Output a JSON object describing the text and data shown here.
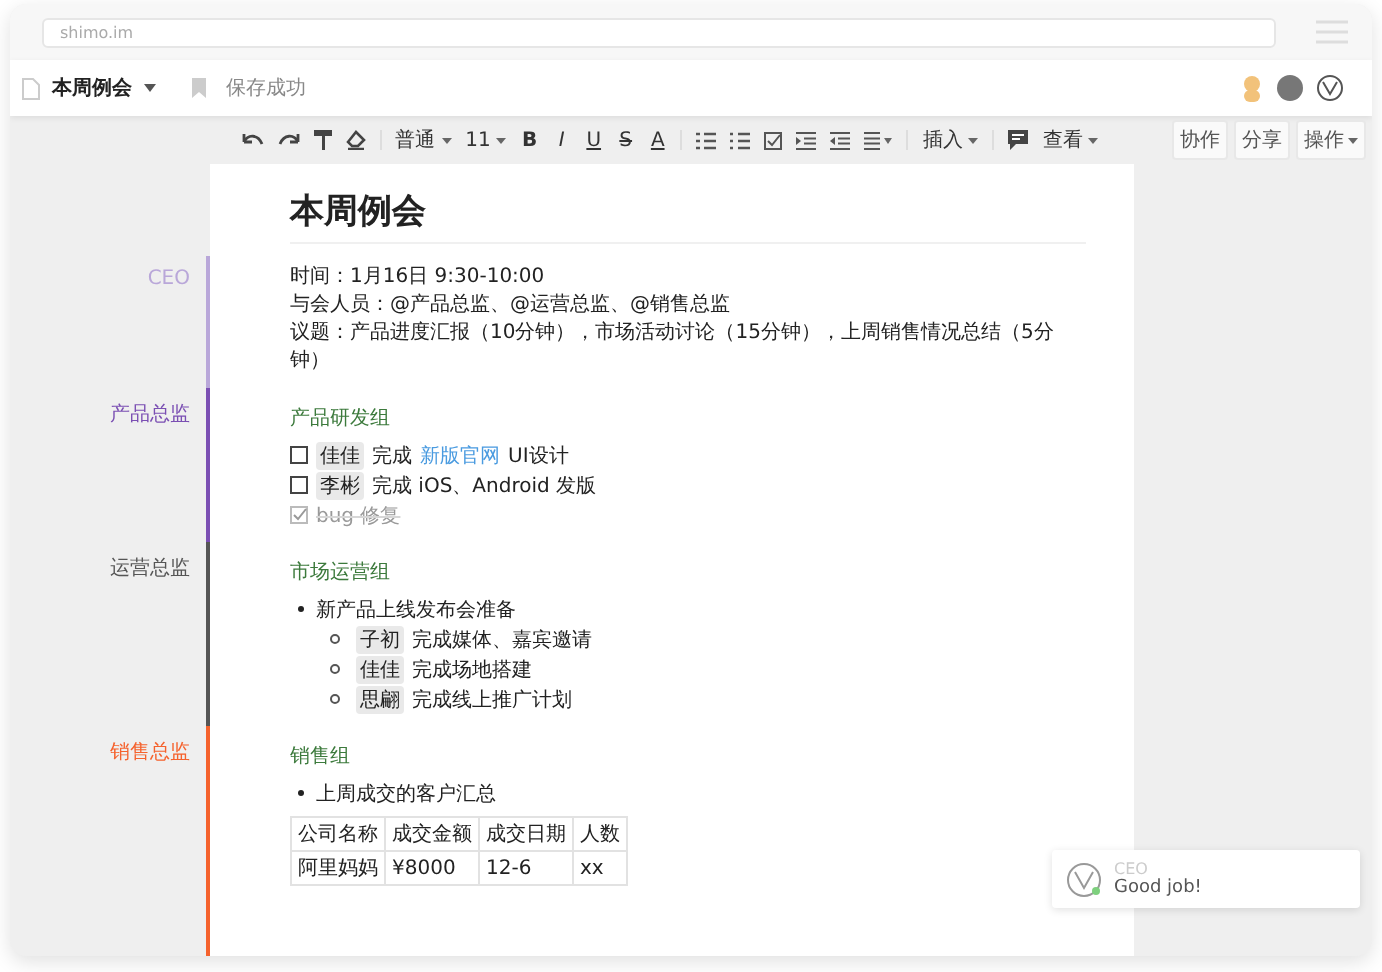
{
  "browser": {
    "url": "shimo.im"
  },
  "header": {
    "doc_title": "本周例会",
    "save_status": "保存成功"
  },
  "toolbar": {
    "style": "普通",
    "font_size": "11",
    "format_buttons": [
      "B",
      "I",
      "U",
      "S",
      "A"
    ],
    "insert": "插入",
    "view": "查看"
  },
  "actions": [
    "协作",
    "分享",
    "操作"
  ],
  "document": {
    "title": "本周例会",
    "sections": [
      {
        "author": "CEO",
        "color": "#b9a7d9",
        "kind": "meta",
        "lines": [
          "时间：1月16日 9:30-10:00",
          "与会人员：@产品总监、@运营总监、@销售总监",
          "议题：产品进度汇报（10分钟），市场活动讨论（15分钟），上周销售情况总结（5分钟）"
        ]
      },
      {
        "author": "产品总监",
        "color": "#7b4fb3",
        "kind": "checklist",
        "heading": "产品研发组",
        "items": [
          {
            "checked": false,
            "mention": "佳佳",
            "text": "完成",
            "link": "新版官网",
            "tail": "UI设计"
          },
          {
            "checked": false,
            "mention": "李彬",
            "text": "完成 iOS、Android 发版"
          },
          {
            "checked": true,
            "text": "bug 修复"
          }
        ]
      },
      {
        "author": "运营总监",
        "color": "#555555",
        "kind": "bullets",
        "heading": "市场运营组",
        "bullet": "新产品上线发布会准备",
        "items": [
          {
            "mention": "子初",
            "text": "完成媒体、嘉宾邀请"
          },
          {
            "mention": "佳佳",
            "text": "完成场地搭建"
          },
          {
            "mention": "思翩",
            "text": "完成线上推广计划"
          }
        ]
      },
      {
        "author": "销售总监",
        "color": "#f5622d",
        "kind": "table",
        "heading": "销售组",
        "bullet": "上周成交的客户汇总",
        "table": {
          "columns": [
            "公司名称",
            "成交金额",
            "成交日期",
            "人数"
          ],
          "rows": [
            [
              "阿里妈妈",
              "¥8000",
              "12-6",
              "xx"
            ]
          ]
        }
      }
    ]
  },
  "comment": {
    "author": "CEO",
    "text": "Good job!"
  }
}
